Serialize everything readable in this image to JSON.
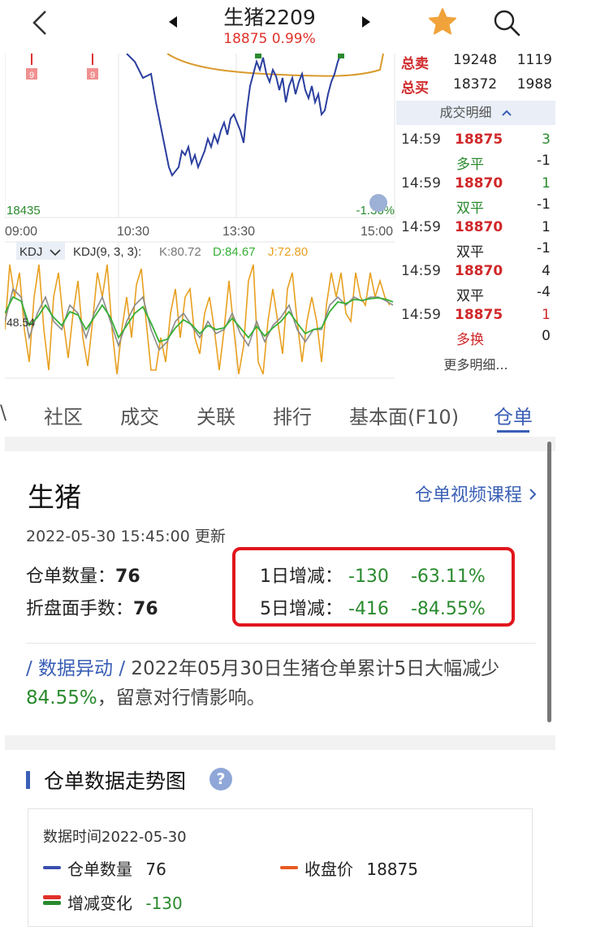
{
  "header": {
    "title": "生猪2209",
    "subtitle": "18875 0.99%"
  },
  "chart": {
    "price_low_label": "18435",
    "pct_label": "-1.36%",
    "time_labels": [
      "09:00",
      "10:30",
      "13:30",
      "15:00"
    ],
    "markers": [
      "9",
      "9"
    ],
    "kdj_selector": "KDJ",
    "kdj_params": "KDJ(9, 3, 3):",
    "kdj_k": "K:80.72",
    "kdj_d": "D:84.67",
    "kdj_j": "J:72.80",
    "kdj_axis_label": "48.54",
    "colors": {
      "price": "#2b3f9e",
      "avg": "#d99a2b",
      "k": "#8a8a8a",
      "d": "#36b036",
      "j": "#e8a020"
    }
  },
  "orderbook": {
    "sell_label": "总卖",
    "sell_price": "19248",
    "sell_vol": "1119",
    "buy_label": "总买",
    "buy_price": "18372",
    "buy_vol": "1988",
    "detail_header": "成交明细",
    "ticks": [
      {
        "time": "14:59",
        "price": "18875",
        "price_color": "#d0282a",
        "vol": "3",
        "vol_color": "#2a8a2e",
        "type": "多平",
        "type_color": "#2a8a2e",
        "oi": "-1"
      },
      {
        "time": "14:59",
        "price": "18870",
        "price_color": "#d0282a",
        "vol": "1",
        "vol_color": "#2a8a2e",
        "type": "双平",
        "type_color": "#2a8a2e",
        "oi": "-1"
      },
      {
        "time": "14:59",
        "price": "18870",
        "price_color": "#d0282a",
        "vol": "1",
        "vol_color": "#222222",
        "type": "双平",
        "type_color": "#222222",
        "oi": "-1"
      },
      {
        "time": "14:59",
        "price": "18870",
        "price_color": "#d0282a",
        "vol": "4",
        "vol_color": "#222222",
        "type": "双平",
        "type_color": "#222222",
        "oi": "-4"
      },
      {
        "time": "14:59",
        "price": "18875",
        "price_color": "#d0282a",
        "vol": "1",
        "vol_color": "#d0282a",
        "type": "多换",
        "type_color": "#d0282a",
        "oi": "0"
      }
    ],
    "more": "更多明细..."
  },
  "tabs": [
    "\\",
    "社区",
    "成交",
    "关联",
    "排行",
    "基本面(F10)",
    "仓单"
  ],
  "card": {
    "product": "生猪",
    "course_link": "仓单视频课程",
    "updated": "2022-05-30 15:45:00 更新",
    "warehouse_qty_label": "仓单数量：",
    "warehouse_qty": "76",
    "folded_label": "折盘面手数：",
    "folded": "76",
    "d1_label": "1日增减：",
    "d1_value": "-130",
    "d1_pct": "-63.11%",
    "d5_label": "5日增减：",
    "d5_value": "-416",
    "d5_pct": "-84.55%",
    "note_tag": "/ 数据异动 /",
    "note_text_1": " 2022年05月30日生猪仓单累计5日大幅减少",
    "note_pct": "84.55%",
    "note_text_2": "，留意对行情影响。"
  },
  "trend": {
    "title": "仓单数据走势图",
    "help": "?",
    "data_time": "数据时间2022-05-30",
    "legend": [
      {
        "label": "仓单数量",
        "value": "76",
        "color": "#3a4fb0"
      },
      {
        "label": "收盘价",
        "value": "18875",
        "color": "#e85a20"
      },
      {
        "label": "增减变化",
        "value": "-130",
        "color": "#2a8a2e"
      }
    ]
  }
}
